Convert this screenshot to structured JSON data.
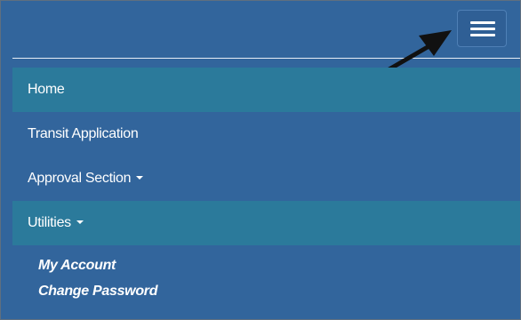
{
  "navbar": {
    "toggle_icon": "hamburger-menu-icon",
    "annotation_icon": "pointer-arrow-icon"
  },
  "menu": {
    "home": "Home",
    "transit_application": "Transit Application",
    "approval_section": "Approval Section",
    "utilities": "Utilities",
    "utilities_submenu": {
      "my_account": "My Account",
      "change_password": "Change Password"
    }
  },
  "colors": {
    "navbar_bg": "#32659c",
    "active_item_bg": "#2b7a9b",
    "text": "#ffffff"
  }
}
